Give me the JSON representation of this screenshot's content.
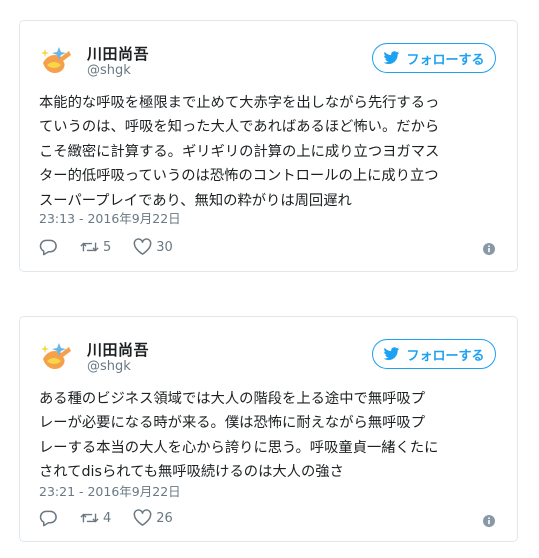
{
  "tweets": [
    {
      "author_name": "川田尚吾",
      "author_handle": "@shgk",
      "follow_label": "フォローする",
      "text": "本能的な呼吸を極限まで止めて大赤字を出しながら先行するっ\nていうのは、呼吸を知った大人であればあるほど怖い。だから\nこそ緻密に計算する。ギリギリの計算の上に成り立つヨガマス\nター的低呼吸っていうのは恐怖のコントロールの上に成り立つ\nスーパープレイであり、無知の粋がりは周回遅れ",
      "timestamp": "23:13 - 2016年9月22日",
      "retweets": "5",
      "likes": "30"
    },
    {
      "author_name": "川田尚吾",
      "author_handle": "@shgk",
      "follow_label": "フォローする",
      "text": "ある種のビジネス領域では大人の階段を上る途中で無呼吸プ\nレーが必要になる時が来る。僕は恐怖に耐えながら無呼吸プ\nレーする本当の大人を心から誇りに思う。呼吸童貞一緒くたに\nされてdisられても無呼吸続けるのは大人の強さ",
      "timestamp": "23:21 - 2016年9月22日",
      "retweets": "4",
      "likes": "26"
    }
  ],
  "colors": {
    "accent": "#1da1f2",
    "secondary_text": "#697882",
    "border": "#e1e8ed",
    "avatar_orange": "#f5a04b",
    "avatar_yellow": "#f7d64a",
    "avatar_blue": "#6bb5e8"
  },
  "icons": {
    "avatar": "hand-sparkle-avatar",
    "follow": "twitter-bird-icon",
    "reply": "reply-icon",
    "retweet": "retweet-icon",
    "like": "heart-icon",
    "info": "info-icon"
  }
}
